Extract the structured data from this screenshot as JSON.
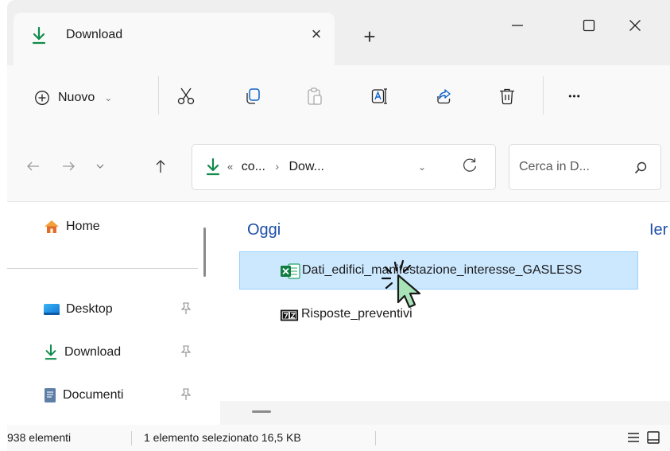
{
  "tab": {
    "title": "Download",
    "close_glyph": "×",
    "new_tab_glyph": "+"
  },
  "toolbar": {
    "new_label": "Nuovo",
    "new_chevron": "⌄",
    "more_glyph": "•••",
    "icons": [
      "cut-icon",
      "copy-icon",
      "paste-icon",
      "rename-icon",
      "share-icon",
      "delete-icon"
    ]
  },
  "address": {
    "prefix": "«",
    "crumb1": "co...",
    "crumb_sep": "›",
    "crumb2": "Dow...",
    "chevron": "⌄"
  },
  "search": {
    "placeholder": "Cerca in D..."
  },
  "sidebar": {
    "home": "Home",
    "items": [
      {
        "label": "Desktop"
      },
      {
        "label": "Download"
      },
      {
        "label": "Documenti"
      }
    ]
  },
  "content": {
    "group_heading": "Oggi",
    "next_column_partial": "Ier",
    "files": [
      {
        "name": "Dati_edifici_manifestazione_interesse_GASLESS",
        "type": "excel",
        "selected": true
      },
      {
        "name": "Risposte_preventivi",
        "type": "7z",
        "selected": false
      }
    ]
  },
  "status": {
    "count": "938 elementi",
    "selection": "1 elemento selezionato  16,5 KB"
  },
  "colors": {
    "accent_green": "#0f8b4a",
    "heading_blue": "#1d4fa8",
    "selection_bg": "#cce8ff",
    "selection_border": "#99d1ff",
    "cursor_fill": "#a7e3b7"
  }
}
